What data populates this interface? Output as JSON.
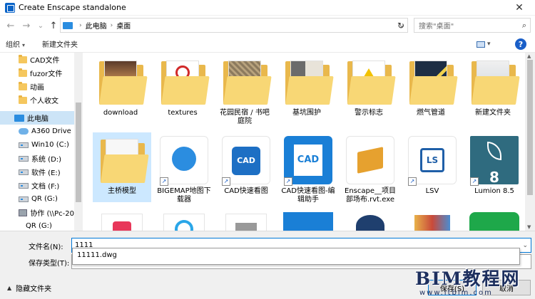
{
  "window": {
    "title": "Create Enscape standalone",
    "close_glyph": "✕"
  },
  "nav": {
    "back": "←",
    "forward": "→",
    "history": "⌄",
    "up": "↑"
  },
  "address": {
    "crumbs": [
      "此电脑",
      "桌面"
    ],
    "refresh": "↻"
  },
  "search": {
    "placeholder": "搜索\"桌面\""
  },
  "toolbar": {
    "organize": "组织",
    "new_folder": "新建文件夹",
    "help": "?"
  },
  "sidebar": {
    "items": [
      {
        "label": "CAD文件",
        "icon": "folder"
      },
      {
        "label": "fuzor文件",
        "icon": "folder"
      },
      {
        "label": "动画",
        "icon": "folder"
      },
      {
        "label": "个人收文",
        "icon": "folder"
      },
      {
        "label": "此电脑",
        "icon": "pc",
        "selected": true
      },
      {
        "label": "A360 Drive",
        "icon": "cloud"
      },
      {
        "label": "Win10 (C:)",
        "icon": "drive"
      },
      {
        "label": "系统 (D:)",
        "icon": "drive"
      },
      {
        "label": "软件 (E:)",
        "icon": "drive"
      },
      {
        "label": "文档 (F:)",
        "icon": "drive"
      },
      {
        "label": "QR (G:)",
        "icon": "drive"
      },
      {
        "label": "协作 (\\\\Pc-20",
        "icon": "network"
      },
      {
        "label": "QR (G:)",
        "icon": "drive"
      }
    ]
  },
  "files": [
    {
      "label": "download",
      "kind": "folder-photo"
    },
    {
      "label": "textures",
      "kind": "folder-sign"
    },
    {
      "label": "花园民宿 / 书吧庭院",
      "kind": "folder-plan"
    },
    {
      "label": "基坑围护",
      "kind": "folder-pit"
    },
    {
      "label": "警示标志",
      "kind": "folder-warning"
    },
    {
      "label": "燃气管道",
      "kind": "folder-pipe"
    },
    {
      "label": "新建文件夹",
      "kind": "folder"
    },
    {
      "label": "主桥模型",
      "kind": "folder-empty",
      "selected": true
    },
    {
      "label": "BIGEMAP地图下载器",
      "kind": "app-bigemap"
    },
    {
      "label": "CAD快速看图",
      "kind": "app-cad"
    },
    {
      "label": "CAD快速看图-编辑助手",
      "kind": "app-cad-edit"
    },
    {
      "label": "Enscape__项目部场布.rvt.exe",
      "kind": "app-enscape"
    },
    {
      "label": "LSV",
      "kind": "app-lsv"
    },
    {
      "label": "Lumion 8.5",
      "kind": "app-lumion"
    }
  ],
  "bottom": {
    "filename_label": "文件名(N):",
    "filename_value": "1111",
    "filetype_label": "保存类型(T):",
    "autocomplete": "11111.dwg",
    "hide_folders": "隐藏文件夹",
    "save": "保存(S)",
    "cancel": "取消"
  },
  "watermark": {
    "title": "BIM教程网",
    "url": "www.itbim.com"
  },
  "colors": {
    "accent": "#0078d7",
    "folder": "#f8d775",
    "selection": "#cce8ff"
  }
}
